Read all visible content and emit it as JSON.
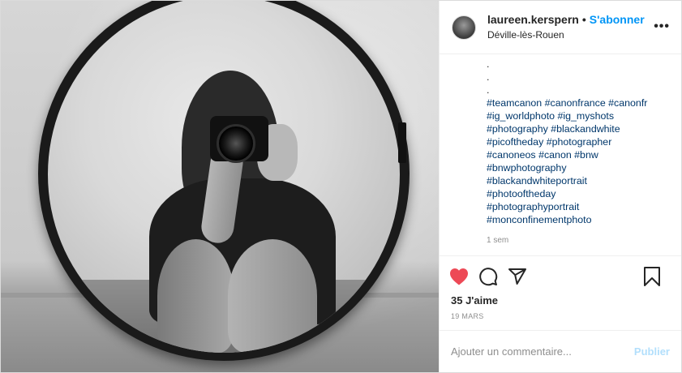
{
  "header": {
    "username": "laureen.kerspern",
    "separator": "•",
    "follow_label": "S'abonner",
    "location": "Déville-lès-Rouen",
    "more_icon": "more-horizontal-icon",
    "more_glyph": "•••"
  },
  "caption": {
    "dots": [
      ".",
      ".",
      "."
    ],
    "lines": [
      "#teamcanon #canonfrance #canonfr",
      "#ig_worldphoto #ig_myshots",
      "#photography #blackandwhite",
      "#picoftheday #photographer",
      "#canoneos #canon #bnw",
      "#bnwphotography",
      "#blackandwhiteportrait",
      "#photooftheday",
      "#photographyportrait",
      "#monconfinementphoto"
    ],
    "time_ago": "1 sem"
  },
  "actions": {
    "like_icon": "heart-filled-icon",
    "comment_icon": "comment-icon",
    "share_icon": "share-icon",
    "save_icon": "bookmark-icon",
    "liked": true,
    "like_color": "#ed4956"
  },
  "likes_text": "35 J'aime",
  "date_text": "19 MARS",
  "comment": {
    "placeholder": "Ajouter un commentaire...",
    "value": "",
    "publish_label": "Publier"
  },
  "colors": {
    "follow": "#0095f6",
    "hashtag": "#00376b",
    "publish_disabled": "#b2dffc"
  }
}
